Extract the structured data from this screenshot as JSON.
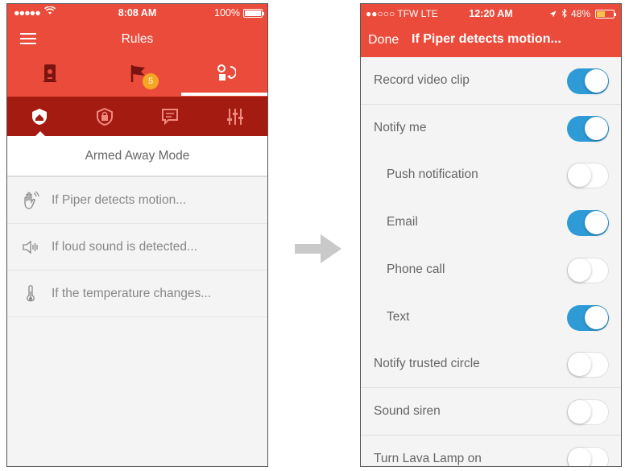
{
  "left_phone": {
    "status": {
      "carrier": "●●●●●",
      "time": "8:08 AM",
      "battery": "100%"
    },
    "title": "Rules",
    "top_tabs": [
      {
        "icon": "device-icon"
      },
      {
        "icon": "flag-icon",
        "badge": "5"
      },
      {
        "icon": "rules-icon",
        "selected": true
      }
    ],
    "modes": [
      {
        "icon": "armed-away-icon",
        "selected": true
      },
      {
        "icon": "armed-stay-icon"
      },
      {
        "icon": "message-icon"
      },
      {
        "icon": "sliders-icon"
      }
    ],
    "mode_title": "Armed Away Mode",
    "rules": [
      {
        "icon": "motion-hand-icon",
        "label": "If Piper detects motion..."
      },
      {
        "icon": "speaker-icon",
        "label": "If loud sound is detected..."
      },
      {
        "icon": "thermometer-icon",
        "label": "If the temperature changes..."
      }
    ]
  },
  "right_phone": {
    "status": {
      "carrier": "●●○○○ TFW  LTE",
      "time": "12:20 AM",
      "battery": "48%"
    },
    "done_label": "Done",
    "title": "If Piper detects motion...",
    "settings": [
      {
        "label": "Record video clip",
        "on": true,
        "indent": false
      },
      {
        "label": "Notify me",
        "on": true,
        "indent": false
      },
      {
        "label": "Push notification",
        "on": false,
        "indent": true
      },
      {
        "label": "Email",
        "on": true,
        "indent": true
      },
      {
        "label": "Phone call",
        "on": false,
        "indent": true
      },
      {
        "label": "Text",
        "on": true,
        "indent": true
      },
      {
        "label": "Notify trusted circle",
        "on": false,
        "indent": false
      },
      {
        "label": "Sound siren",
        "on": false,
        "indent": false
      },
      {
        "label": "Turn Lava Lamp on",
        "on": false,
        "indent": false
      }
    ]
  },
  "colors": {
    "header_red": "#ea4b3b",
    "mode_bar_red": "#a41b12",
    "toggle_blue": "#2e9bd6",
    "badge_orange": "#f5a623"
  }
}
